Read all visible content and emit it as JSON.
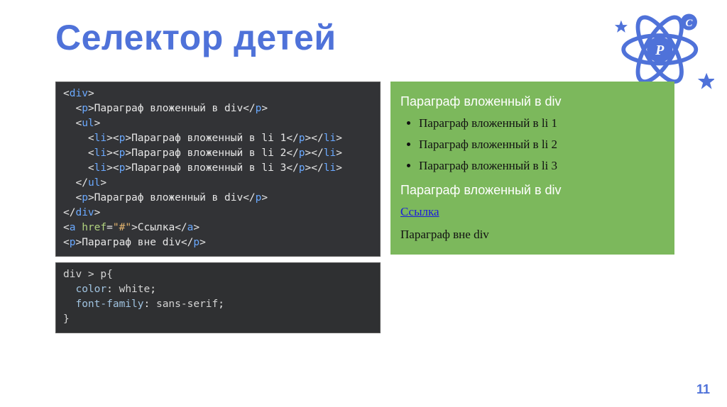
{
  "title": "Селектор детей",
  "page_number": "11",
  "code_html": {
    "lines": [
      {
        "t": "open",
        "tag": "div",
        "indent": 0
      },
      {
        "t": "full",
        "tag": "p",
        "text": "Параграф вложенный в div",
        "indent": 2
      },
      {
        "t": "open",
        "tag": "ul",
        "indent": 2
      },
      {
        "t": "li_p",
        "text": "Параграф вложенный в li 1",
        "indent": 4
      },
      {
        "t": "li_p",
        "text": "Параграф вложенный в li 2",
        "indent": 4
      },
      {
        "t": "li_p",
        "text": "Параграф вложенный в li 3",
        "indent": 4
      },
      {
        "t": "close",
        "tag": "ul",
        "indent": 2
      },
      {
        "t": "full",
        "tag": "p",
        "text": "Параграф вложенный в div",
        "indent": 2
      },
      {
        "t": "close",
        "tag": "div",
        "indent": 0
      },
      {
        "t": "a",
        "href": "#",
        "text": "Ссылка",
        "indent": 0
      },
      {
        "t": "full",
        "tag": "p",
        "text": "Параграф вне div",
        "indent": 0
      }
    ]
  },
  "code_css": {
    "selector": "div > p",
    "rules": [
      {
        "prop": "color",
        "val": "white"
      },
      {
        "prop": "font-family",
        "val": "sans-serif"
      }
    ]
  },
  "preview": {
    "p_div_1": "Параграф вложенный в div",
    "li": [
      "Параграф вложенный в li 1",
      "Параграф вложенный в li 2",
      "Параграф вложенный в li 3"
    ],
    "p_div_2": "Параграф вложенный в div",
    "link": "Ссылка",
    "p_outer": "Параграф вне div"
  }
}
